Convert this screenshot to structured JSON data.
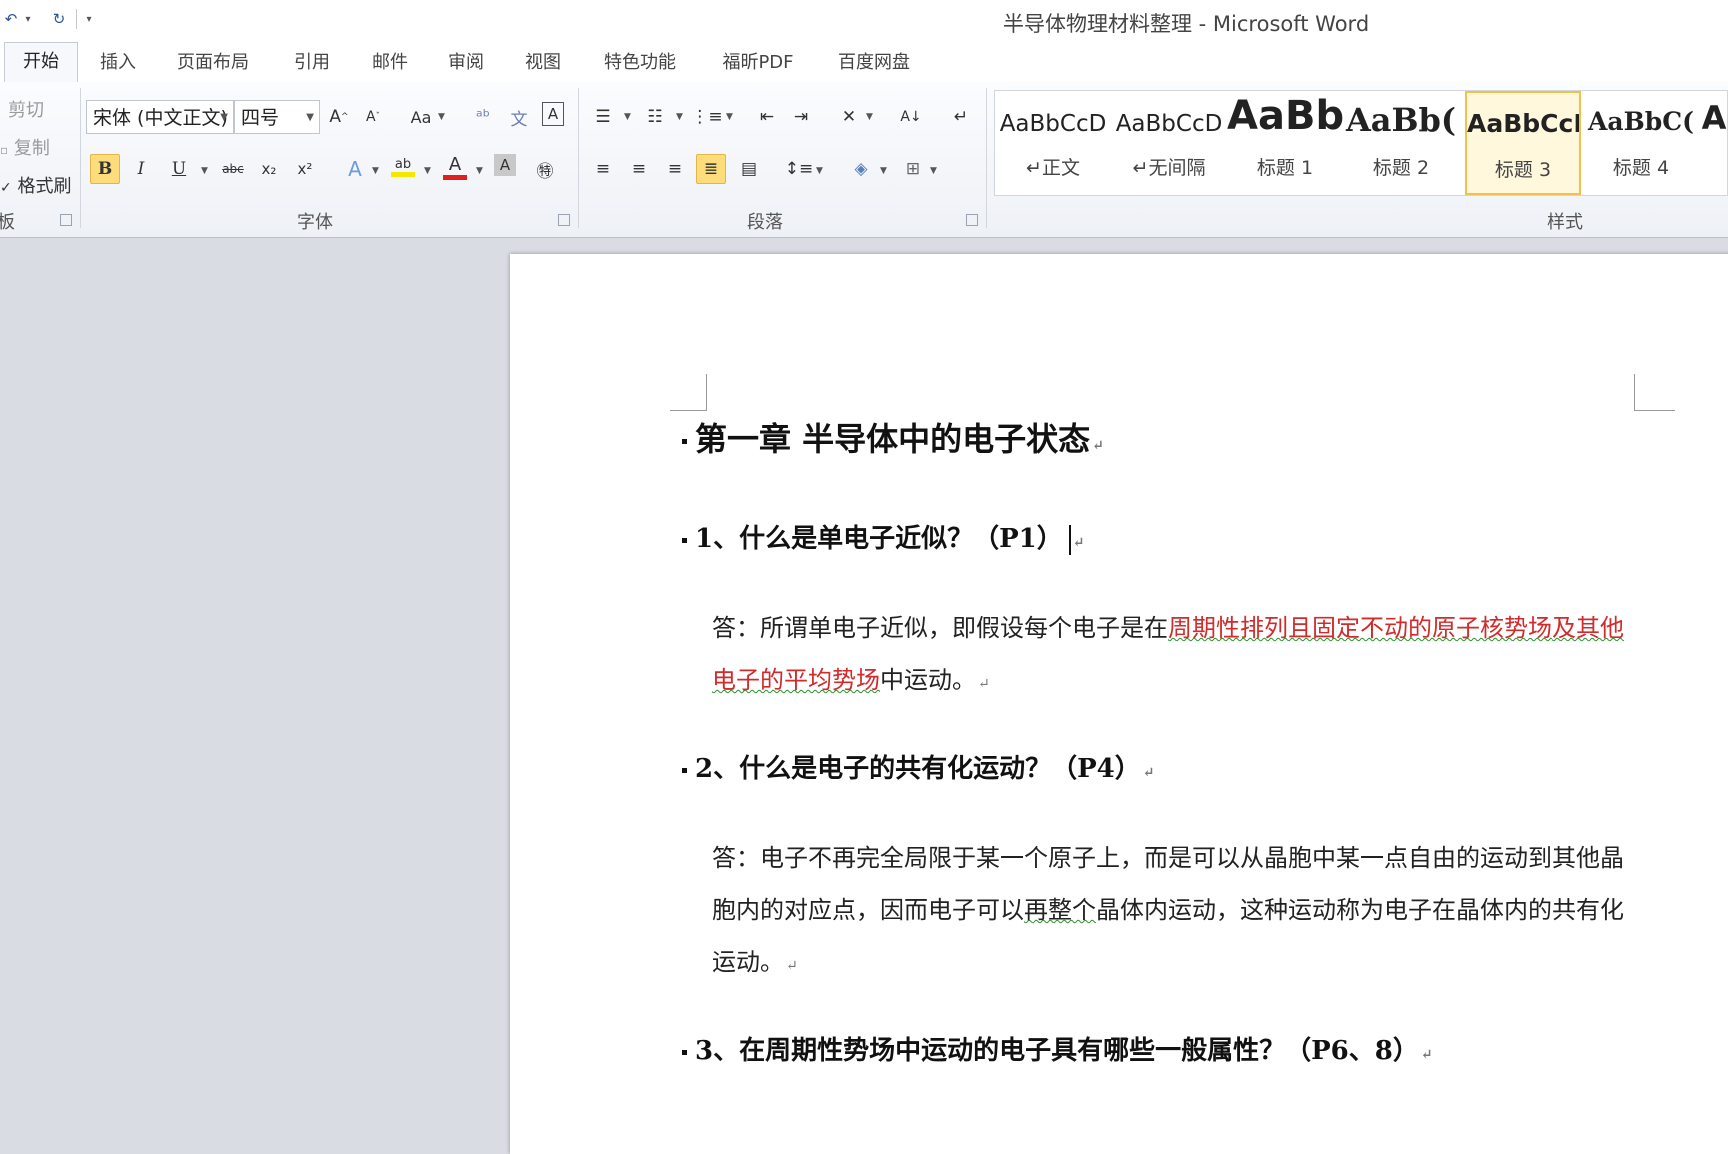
{
  "window": {
    "title": "半导体物理材料整理 - Microsoft Word"
  },
  "qat": {
    "undo_icon": "undo-icon",
    "redo_icon": "redo-icon",
    "customize_icon": "customize-qat-icon"
  },
  "tabs": [
    {
      "label": "开始"
    },
    {
      "label": "插入"
    },
    {
      "label": "页面布局"
    },
    {
      "label": "引用"
    },
    {
      "label": "邮件"
    },
    {
      "label": "审阅"
    },
    {
      "label": "视图"
    },
    {
      "label": "特色功能"
    },
    {
      "label": "福昕PDF"
    },
    {
      "label": "百度网盘"
    }
  ],
  "clipboard": {
    "cut": "剪切",
    "copy": "复制",
    "format_painter": "格式刷",
    "group": "板"
  },
  "font": {
    "name": "宋体 (中文正文)",
    "size": "四号",
    "group": "字体",
    "underline_color": "#e02020",
    "highlight_color": "#f5e800"
  },
  "paragraph": {
    "group": "段落"
  },
  "styles": {
    "group": "样式",
    "items": [
      {
        "sample": "AaBbCcD",
        "name": "↵正文"
      },
      {
        "sample": "AaBbCcD",
        "name": "↵无间隔"
      },
      {
        "sample": "AaBb",
        "name": "标题 1"
      },
      {
        "sample": "AaBb(",
        "name": "标题 2"
      },
      {
        "sample": "AaBbCcI",
        "name": "标题 3"
      },
      {
        "sample": "AaBbC(",
        "name": "标题 4"
      },
      {
        "sample": "A",
        "name": ""
      }
    ]
  },
  "document": {
    "chapter": "第一章  半导体中的电子状态",
    "q1": "1、什么是单电子近似？（P1）",
    "a1_prefix": "答：所谓单电子近似，即假设每个电子是在",
    "a1_red1": "周期性排列且固定不动的原子核势场",
    "a1_red2": "及其他电子的平均势场",
    "a1_suffix": "中运动。",
    "q2": "2、什么是电子的共有化运动？（P4）",
    "a2_part1": "答：电子不再完全局限于某一个原子上，而是可以从晶胞中某一点自由的运动到其他晶胞内的对应点，因而电子可以",
    "a2_squig": "再整个",
    "a2_part2": "晶体内运动，这种运动称为电子在晶体内的共有化运动。",
    "q3": "3、在周期性势场中运动的电子具有哪些一般属性？（P6、8）",
    "para_mark": "↵"
  }
}
